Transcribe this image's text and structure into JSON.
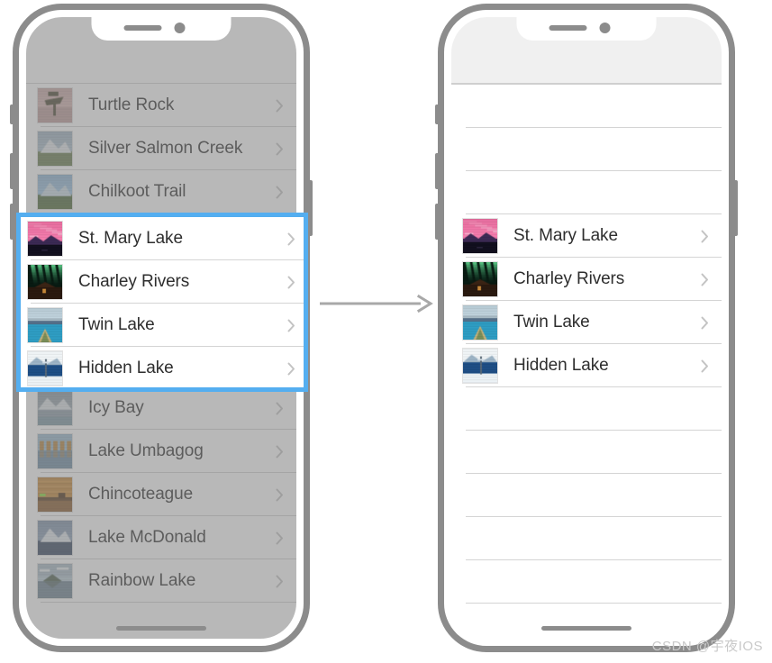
{
  "meta": {
    "watermark": "CSDN @宇夜IOS",
    "accent_blue": "#54aef0",
    "frame_gray": "#8c8c8c",
    "separator": "#d4d4d4",
    "label_color": "#2e2e2e",
    "chevron_color": "#c3c3c3",
    "statusbar_color": "#f0f0f0"
  },
  "left_phone": {
    "name": "landmark-list-before",
    "dimmed": true,
    "chevron": "›",
    "rows": [
      {
        "label": "Turtle Rock",
        "thumb": "turtle-rock",
        "highlighted": false
      },
      {
        "label": "Silver Salmon Creek",
        "thumb": "silver-salmon-creek",
        "highlighted": false
      },
      {
        "label": "Chilkoot Trail",
        "thumb": "chilkoot-trail",
        "highlighted": false
      },
      {
        "label": "St. Mary Lake",
        "thumb": "st-mary-lake",
        "highlighted": true
      },
      {
        "label": "Charley Rivers",
        "thumb": "charley-rivers",
        "highlighted": true
      },
      {
        "label": "Twin Lake",
        "thumb": "twin-lake",
        "highlighted": true
      },
      {
        "label": "Hidden Lake",
        "thumb": "hidden-lake",
        "highlighted": true
      },
      {
        "label": "Icy Bay",
        "thumb": "icy-bay",
        "highlighted": false
      },
      {
        "label": "Lake Umbagog",
        "thumb": "lake-umbagog",
        "highlighted": false
      },
      {
        "label": "Chincoteague",
        "thumb": "chincoteague",
        "highlighted": false
      },
      {
        "label": "Lake McDonald",
        "thumb": "lake-mcdonald",
        "highlighted": false
      },
      {
        "label": "Rainbow Lake",
        "thumb": "rainbow-lake",
        "highlighted": false
      }
    ]
  },
  "right_phone": {
    "name": "landmark-list-after",
    "dimmed": false,
    "chevron": "›",
    "rows": [
      {
        "label": "",
        "thumb": null,
        "empty": true
      },
      {
        "label": "",
        "thumb": null,
        "empty": true
      },
      {
        "label": "",
        "thumb": null,
        "empty": true
      },
      {
        "label": "St. Mary Lake",
        "thumb": "st-mary-lake",
        "empty": false
      },
      {
        "label": "Charley Rivers",
        "thumb": "charley-rivers",
        "empty": false
      },
      {
        "label": "Twin Lake",
        "thumb": "twin-lake",
        "empty": false
      },
      {
        "label": "Hidden Lake",
        "thumb": "hidden-lake",
        "empty": false
      },
      {
        "label": "",
        "thumb": null,
        "empty": true
      },
      {
        "label": "",
        "thumb": null,
        "empty": true
      },
      {
        "label": "",
        "thumb": null,
        "empty": true
      },
      {
        "label": "",
        "thumb": null,
        "empty": true
      },
      {
        "label": "",
        "thumb": null,
        "empty": true
      }
    ]
  },
  "thumbnails": {
    "turtle-rock": {
      "sky": "#caa8a6",
      "ground": "#8c6a4e",
      "subject": "tree",
      "subject_color": "#4a4630"
    },
    "silver-salmon-creek": {
      "sky": "#9fb3c2",
      "ground": "#6f8356",
      "subject": "mountain",
      "subject_color": "#e6ebee"
    },
    "chilkoot-trail": {
      "sky": "#8fb6d6",
      "ground": "#54703f",
      "subject": "mountain",
      "subject_color": "#cfe0ea"
    },
    "st-mary-lake": {
      "sky": "#e86fa0",
      "ground": "#1a1630",
      "subject": "sunset",
      "subject_color": "#3c2a55"
    },
    "charley-rivers": {
      "sky": "#0e2a1c",
      "ground": "#24180f",
      "subject": "aurora",
      "subject_color": "#46d47a"
    },
    "twin-lake": {
      "sky": "#b9ccd6",
      "ground": "#2f9ec4",
      "subject": "canoe",
      "subject_color": "#c8b27a"
    },
    "hidden-lake": {
      "sky": "#dfe8ee",
      "ground": "#1f4f86",
      "subject": "snow",
      "subject_color": "#f2f6f8"
    },
    "icy-bay": {
      "sky": "#8d9aa4",
      "ground": "#7c8f95",
      "subject": "glacier",
      "subject_color": "#dfe7ea"
    },
    "lake-umbagog": {
      "sky": "#9fc0d6",
      "ground": "#6f8ea6",
      "subject": "autumn",
      "subject_color": "#b9863f"
    },
    "chincoteague": {
      "sky": "#c98b3a",
      "ground": "#8a5a2a",
      "subject": "marsh",
      "subject_color": "#5a3a1c"
    },
    "lake-mcdonald": {
      "sky": "#7f93ab",
      "ground": "#3c4c66",
      "subject": "mountain",
      "subject_color": "#e3eaf0"
    },
    "rainbow-lake": {
      "sky": "#adc0cc",
      "ground": "#6e8494",
      "subject": "reflect",
      "subject_color": "#4e6150"
    }
  }
}
